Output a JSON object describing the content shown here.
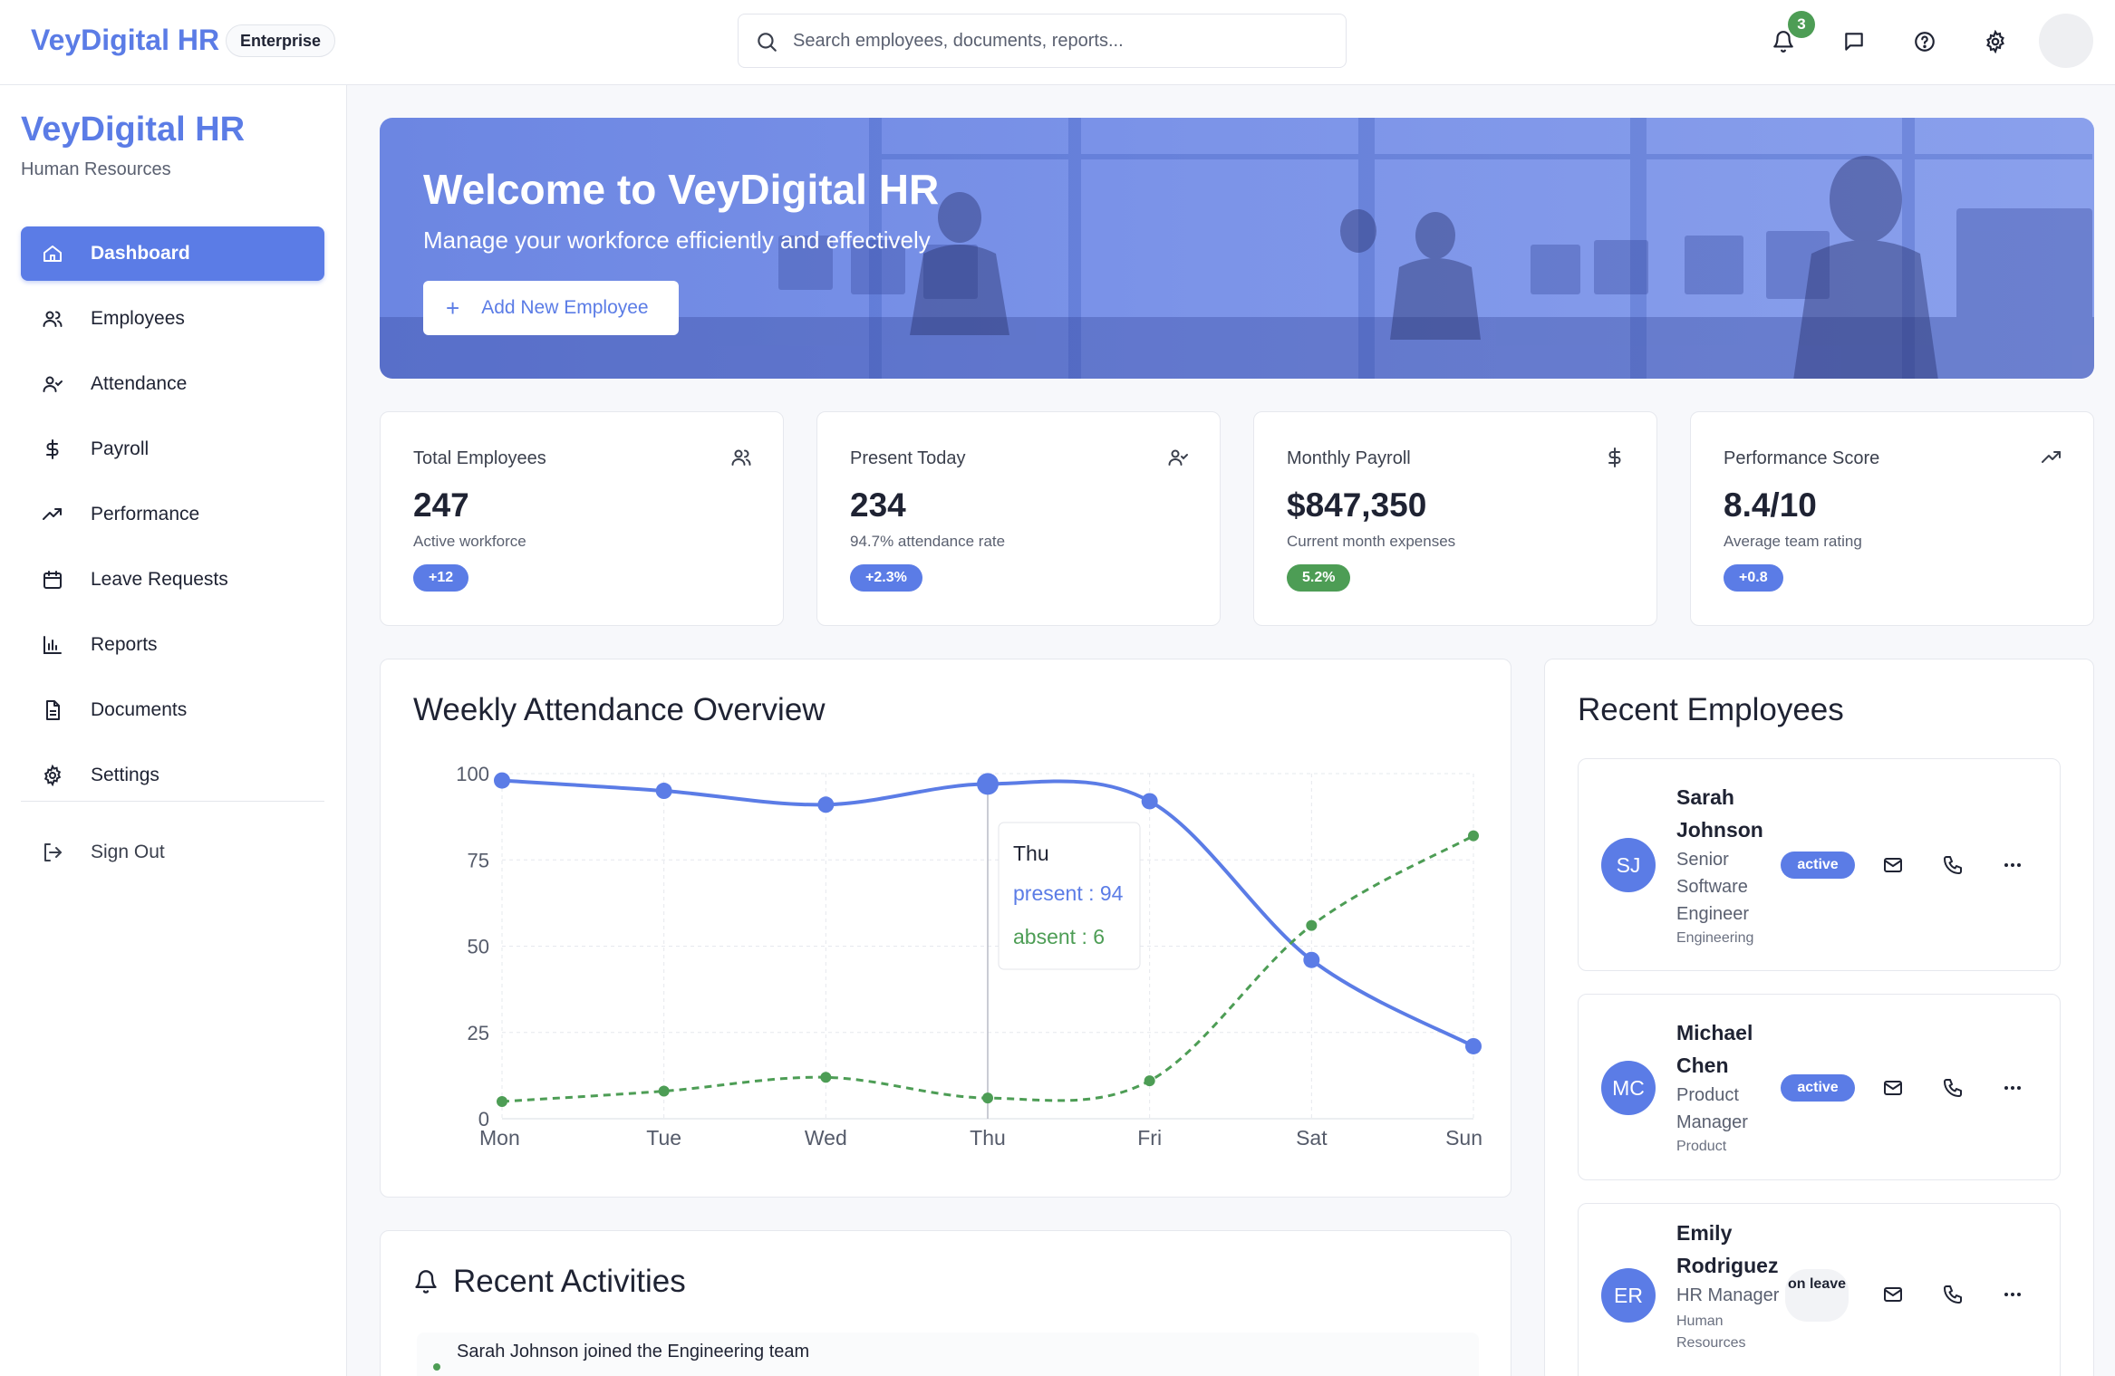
{
  "topbar": {
    "brand": "VeyDigital HR",
    "plan": "Enterprise",
    "search_placeholder": "Search employees, documents, reports...",
    "notification_count": "3",
    "icons": [
      "bell-icon",
      "message-icon",
      "help-icon",
      "gear-icon"
    ]
  },
  "sidebar": {
    "title": "VeyDigital HR",
    "subtitle": "Human Resources",
    "items": [
      {
        "label": "Dashboard",
        "icon": "home-icon",
        "active": true
      },
      {
        "label": "Employees",
        "icon": "users-icon"
      },
      {
        "label": "Attendance",
        "icon": "user-check-icon"
      },
      {
        "label": "Payroll",
        "icon": "dollar-icon"
      },
      {
        "label": "Performance",
        "icon": "trending-up-icon"
      },
      {
        "label": "Leave Requests",
        "icon": "calendar-icon"
      },
      {
        "label": "Reports",
        "icon": "bar-chart-icon"
      },
      {
        "label": "Documents",
        "icon": "document-icon"
      },
      {
        "label": "Settings",
        "icon": "gear-icon"
      }
    ],
    "sign_out": "Sign Out"
  },
  "hero": {
    "title": "Welcome to VeyDigital HR",
    "subtitle": "Manage your workforce efficiently and effectively",
    "button": "Add New Employee"
  },
  "stats": [
    {
      "label": "Total Employees",
      "value": "247",
      "note": "Active workforce",
      "change": "+12",
      "change_color": "#5b7ce6",
      "icon": "users-icon"
    },
    {
      "label": "Present Today",
      "value": "234",
      "note": "94.7% attendance rate",
      "change": "+2.3%",
      "change_color": "#5b7ce6",
      "icon": "user-check-icon"
    },
    {
      "label": "Monthly Payroll",
      "value": "$847,350",
      "note": "Current month expenses",
      "change": "5.2%",
      "change_color": "#4d9d55",
      "icon": "dollar-icon"
    },
    {
      "label": "Performance Score",
      "value": "8.4/10",
      "note": "Average team rating",
      "change": "+0.8",
      "change_color": "#5b7ce6",
      "icon": "trending-up-icon"
    }
  ],
  "chart_card": {
    "title": "Weekly Attendance Overview",
    "tooltip": {
      "day": "Thu",
      "present": "present : 94",
      "absent": "absent : 6"
    }
  },
  "chart_data": {
    "type": "line",
    "categories": [
      "Mon",
      "Tue",
      "Wed",
      "Thu",
      "Fri",
      "Sat",
      "Sun"
    ],
    "series": [
      {
        "name": "present",
        "values": [
          98,
          95,
          91,
          97,
          92,
          46,
          21
        ],
        "color": "#5b7ce6",
        "style": "solid"
      },
      {
        "name": "absent",
        "values": [
          5,
          8,
          12,
          6,
          11,
          56,
          82
        ],
        "color": "#4d9d55",
        "style": "dashed"
      }
    ],
    "yticks": [
      0,
      25,
      50,
      75,
      100
    ],
    "ylim": [
      0,
      100
    ],
    "grid": true
  },
  "recent_employees": {
    "title": "Recent Employees",
    "items": [
      {
        "initials": "SJ",
        "name": "Sarah Johnson",
        "role": "Senior Software Engineer",
        "department": "Engineering",
        "status": "active"
      },
      {
        "initials": "MC",
        "name": "Michael Chen",
        "role": "Product Manager",
        "department": "Product",
        "status": "active"
      },
      {
        "initials": "ER",
        "name": "Emily Rodriguez",
        "role": "HR Manager",
        "department": "Human Resources",
        "status": "on leave"
      }
    ]
  },
  "recent_activities": {
    "title": "Recent Activities",
    "items": [
      {
        "text": "Sarah Johnson joined the Engineering team"
      }
    ]
  }
}
